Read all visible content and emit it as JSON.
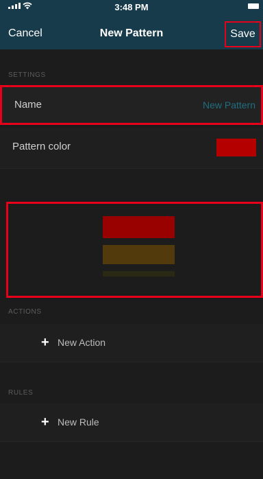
{
  "status_bar": {
    "time": "3:48 PM"
  },
  "nav": {
    "cancel": "Cancel",
    "title": "New Pattern",
    "save": "Save"
  },
  "settings": {
    "header": "SETTINGS",
    "name_label": "Name",
    "name_value": "New Pattern",
    "color_label": "Pattern color",
    "color_value": "#b50000"
  },
  "preview": {
    "colors": [
      "#990000",
      "#523a0d",
      "#2a2a14"
    ]
  },
  "actions": {
    "header": "ACTIONS",
    "add_label": "New Action"
  },
  "rules": {
    "header": "RULES",
    "add_label": "New Rule"
  }
}
